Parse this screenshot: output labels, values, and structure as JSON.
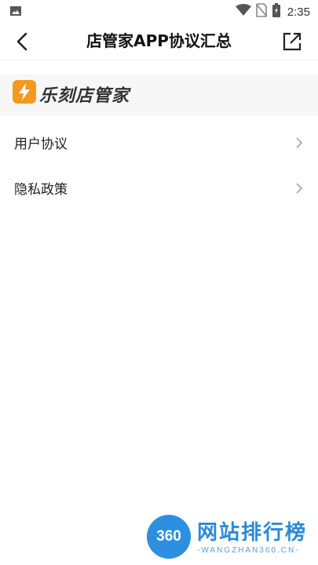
{
  "status_bar": {
    "time": "2:35",
    "icons": [
      "image-icon",
      "wifi-icon",
      "no-sim-icon",
      "battery-icon"
    ]
  },
  "app_bar": {
    "title": "店管家APP协议汇总",
    "back_icon": "back-arrow-icon",
    "share_icon": "external-link-icon"
  },
  "brand": {
    "name": "乐刻店管家",
    "logo_color": "#f39a1e"
  },
  "agreements": [
    {
      "label": "用户协议"
    },
    {
      "label": "隐私政策"
    }
  ],
  "watermark": {
    "badge": "360",
    "title": "网站排行榜",
    "subtitle": "-WANGZHAN360.CN-",
    "color": "#2b8ad9"
  }
}
